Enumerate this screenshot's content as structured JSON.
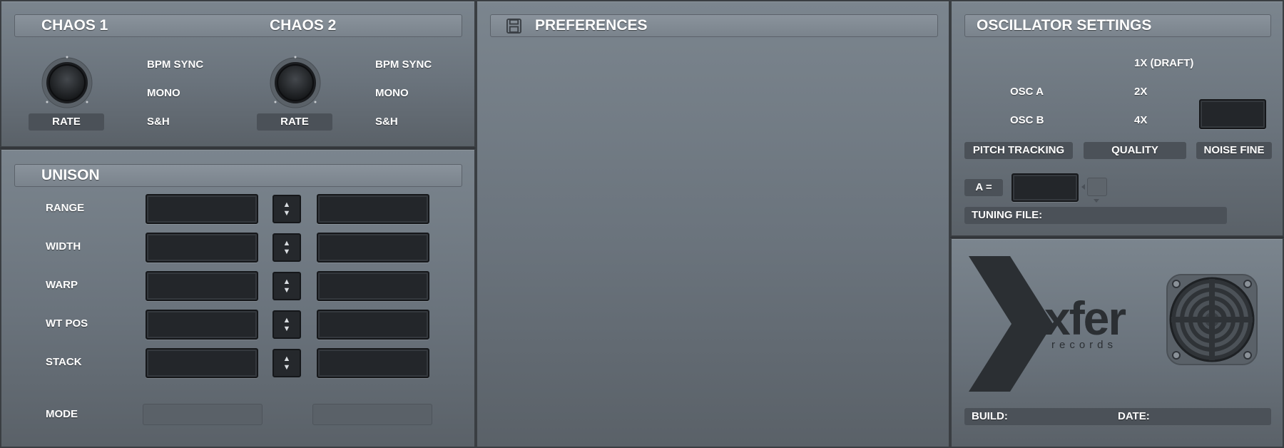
{
  "chaos": {
    "chaos1_title": "CHAOS 1",
    "chaos2_title": "CHAOS 2",
    "rate_label": "RATE",
    "bpm_sync": "BPM SYNC",
    "mono": "MONO",
    "sh": "S&H"
  },
  "unison": {
    "title": "UNISON",
    "rows": [
      "RANGE",
      "WIDTH",
      "WARP",
      "WT POS",
      "STACK"
    ],
    "mode_label": "MODE"
  },
  "preferences": {
    "title": "PREFERENCES",
    "icon": "save-icon"
  },
  "osc_settings": {
    "title": "OSCILLATOR SETTINGS",
    "quality_options": [
      "1X (DRAFT)",
      "2X",
      "4X"
    ],
    "osc_a": "OSC A",
    "osc_b": "OSC B",
    "pitch_tracking": "PITCH TRACKING",
    "quality": "QUALITY",
    "noise_fine": "NOISE FINE",
    "a_equals": "A =",
    "tuning_file": "TUNING FILE:"
  },
  "about": {
    "logo_text": "xfer",
    "logo_subtext": "records",
    "build_label": "BUILD:",
    "date_label": "DATE:"
  }
}
